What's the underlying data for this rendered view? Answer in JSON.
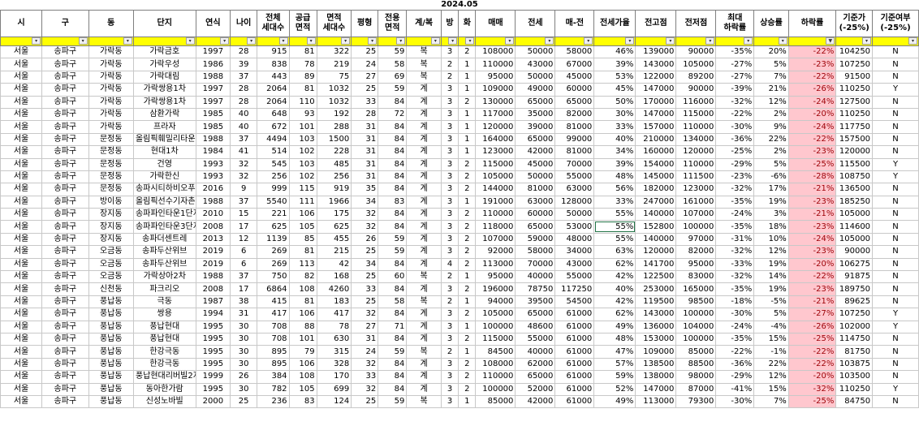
{
  "sheet": {
    "date_label": "2024.05",
    "headers": [
      "시",
      "구",
      "동",
      "단지",
      "연식",
      "나이",
      "전체\n세대수",
      "공급\n면적",
      "면적\n세대수",
      "평형",
      "전용\n면적",
      "계/복",
      "방",
      "화",
      "매매",
      "전세",
      "매-전",
      "전세가율",
      "전고점",
      "전저점",
      "최대\n하락률",
      "상승률",
      "하락률",
      "기준가\n(-25%)",
      "기준여부\n(-25%)"
    ],
    "filter_icons": {
      "default": "dropdown-arrow-icon",
      "active": "filter-icon"
    },
    "rows": [
      [
        "서울",
        "송파구",
        "가락동",
        "가락금호",
        "1997",
        "28",
        "915",
        "81",
        "322",
        "25",
        "59",
        "복",
        "3",
        "2",
        "108000",
        "50000",
        "58000",
        "46%",
        "139000",
        "90000",
        "-35%",
        "20%",
        "-22%",
        "104250",
        "N"
      ],
      [
        "서울",
        "송파구",
        "가락동",
        "가락우성",
        "1986",
        "39",
        "838",
        "78",
        "219",
        "24",
        "58",
        "복",
        "2",
        "1",
        "110000",
        "43000",
        "67000",
        "39%",
        "143000",
        "105000",
        "-27%",
        "5%",
        "-23%",
        "107250",
        "N"
      ],
      [
        "서울",
        "송파구",
        "가락동",
        "가락대림",
        "1988",
        "37",
        "443",
        "89",
        "75",
        "27",
        "69",
        "복",
        "2",
        "1",
        "95000",
        "50000",
        "45000",
        "53%",
        "122000",
        "89200",
        "-27%",
        "7%",
        "-22%",
        "91500",
        "N"
      ],
      [
        "서울",
        "송파구",
        "가락동",
        "가락쌍용1차",
        "1997",
        "28",
        "2064",
        "81",
        "1032",
        "25",
        "59",
        "계",
        "3",
        "1",
        "109000",
        "49000",
        "60000",
        "45%",
        "147000",
        "90000",
        "-39%",
        "21%",
        "-26%",
        "110250",
        "Y"
      ],
      [
        "서울",
        "송파구",
        "가락동",
        "가락쌍용1차",
        "1997",
        "28",
        "2064",
        "110",
        "1032",
        "33",
        "84",
        "계",
        "3",
        "2",
        "130000",
        "65000",
        "65000",
        "50%",
        "170000",
        "116000",
        "-32%",
        "12%",
        "-24%",
        "127500",
        "N"
      ],
      [
        "서울",
        "송파구",
        "가락동",
        "삼환가락",
        "1985",
        "40",
        "648",
        "93",
        "192",
        "28",
        "72",
        "계",
        "3",
        "1",
        "117000",
        "35000",
        "82000",
        "30%",
        "147000",
        "115000",
        "-22%",
        "2%",
        "-20%",
        "110250",
        "N"
      ],
      [
        "서울",
        "송파구",
        "가락동",
        "프라자",
        "1985",
        "40",
        "672",
        "101",
        "288",
        "31",
        "84",
        "계",
        "3",
        "1",
        "120000",
        "39000",
        "81000",
        "33%",
        "157000",
        "110000",
        "-30%",
        "9%",
        "-24%",
        "117750",
        "N"
      ],
      [
        "서울",
        "송파구",
        "문정동",
        "올림픽훼밀리타운",
        "1988",
        "37",
        "4494",
        "103",
        "1500",
        "31",
        "84",
        "계",
        "3",
        "1",
        "164000",
        "65000",
        "99000",
        "40%",
        "210000",
        "134000",
        "-36%",
        "22%",
        "-22%",
        "157500",
        "N"
      ],
      [
        "서울",
        "송파구",
        "문정동",
        "현대1차",
        "1984",
        "41",
        "514",
        "102",
        "228",
        "31",
        "84",
        "계",
        "3",
        "1",
        "123000",
        "42000",
        "81000",
        "34%",
        "160000",
        "120000",
        "-25%",
        "2%",
        "-23%",
        "120000",
        "N"
      ],
      [
        "서울",
        "송파구",
        "문정동",
        "건영",
        "1993",
        "32",
        "545",
        "103",
        "485",
        "31",
        "84",
        "계",
        "3",
        "2",
        "115000",
        "45000",
        "70000",
        "39%",
        "154000",
        "110000",
        "-29%",
        "5%",
        "-25%",
        "115500",
        "Y"
      ],
      [
        "서울",
        "송파구",
        "문정동",
        "가락한신",
        "1993",
        "32",
        "256",
        "102",
        "256",
        "31",
        "84",
        "계",
        "3",
        "2",
        "105000",
        "50000",
        "55000",
        "48%",
        "145000",
        "111500",
        "-23%",
        "-6%",
        "-28%",
        "108750",
        "Y"
      ],
      [
        "서울",
        "송파구",
        "문정동",
        "송파시티하비오푸르지오",
        "2016",
        "9",
        "999",
        "115",
        "919",
        "35",
        "84",
        "계",
        "3",
        "2",
        "144000",
        "81000",
        "63000",
        "56%",
        "182000",
        "123000",
        "-32%",
        "17%",
        "-21%",
        "136500",
        "N"
      ],
      [
        "서울",
        "송파구",
        "방이동",
        "올림픽선수기자촌",
        "1988",
        "37",
        "5540",
        "111",
        "1966",
        "34",
        "83",
        "계",
        "3",
        "1",
        "191000",
        "63000",
        "128000",
        "33%",
        "247000",
        "161000",
        "-35%",
        "19%",
        "-23%",
        "185250",
        "N"
      ],
      [
        "서울",
        "송파구",
        "장지동",
        "송파파인타운1단지",
        "2010",
        "15",
        "221",
        "106",
        "175",
        "32",
        "84",
        "계",
        "3",
        "2",
        "110000",
        "60000",
        "50000",
        "55%",
        "140000",
        "107000",
        "-24%",
        "3%",
        "-21%",
        "105000",
        "N"
      ],
      [
        "서울",
        "송파구",
        "장지동",
        "송파파인타운3단지",
        "2008",
        "17",
        "625",
        "105",
        "625",
        "32",
        "84",
        "계",
        "3",
        "2",
        "118000",
        "65000",
        "53000",
        "55%",
        "152800",
        "100000",
        "-35%",
        "18%",
        "-23%",
        "114600",
        "N"
      ],
      [
        "서울",
        "송파구",
        "장지동",
        "송파더센트레",
        "2013",
        "12",
        "1139",
        "85",
        "455",
        "26",
        "59",
        "계",
        "3",
        "2",
        "107000",
        "59000",
        "48000",
        "55%",
        "140000",
        "97000",
        "-31%",
        "10%",
        "-24%",
        "105000",
        "N"
      ],
      [
        "서울",
        "송파구",
        "오금동",
        "송파두산위브",
        "2019",
        "6",
        "269",
        "81",
        "215",
        "25",
        "59",
        "계",
        "3",
        "2",
        "92000",
        "58000",
        "34000",
        "63%",
        "120000",
        "82000",
        "-32%",
        "12%",
        "-23%",
        "90000",
        "N"
      ],
      [
        "서울",
        "송파구",
        "오금동",
        "송파두산위브",
        "2019",
        "6",
        "269",
        "113",
        "42",
        "34",
        "84",
        "계",
        "4",
        "2",
        "113000",
        "70000",
        "43000",
        "62%",
        "141700",
        "95000",
        "-33%",
        "19%",
        "-20%",
        "106275",
        "N"
      ],
      [
        "서울",
        "송파구",
        "오금동",
        "가락상아2차",
        "1988",
        "37",
        "750",
        "82",
        "168",
        "25",
        "60",
        "복",
        "2",
        "1",
        "95000",
        "40000",
        "55000",
        "42%",
        "122500",
        "83000",
        "-32%",
        "14%",
        "-22%",
        "91875",
        "N"
      ],
      [
        "서울",
        "송파구",
        "신천동",
        "파크리오",
        "2008",
        "17",
        "6864",
        "108",
        "4260",
        "33",
        "84",
        "계",
        "3",
        "2",
        "196000",
        "78750",
        "117250",
        "40%",
        "253000",
        "165000",
        "-35%",
        "19%",
        "-23%",
        "189750",
        "N"
      ],
      [
        "서울",
        "송파구",
        "풍납동",
        "극동",
        "1987",
        "38",
        "415",
        "81",
        "183",
        "25",
        "58",
        "복",
        "2",
        "1",
        "94000",
        "39500",
        "54500",
        "42%",
        "119500",
        "98500",
        "-18%",
        "-5%",
        "-21%",
        "89625",
        "N"
      ],
      [
        "서울",
        "송파구",
        "풍납동",
        "쌍용",
        "1994",
        "31",
        "417",
        "106",
        "417",
        "32",
        "84",
        "계",
        "3",
        "2",
        "105000",
        "65000",
        "61000",
        "62%",
        "143000",
        "100000",
        "-30%",
        "5%",
        "-27%",
        "107250",
        "Y"
      ],
      [
        "서울",
        "송파구",
        "풍납동",
        "풍납현대",
        "1995",
        "30",
        "708",
        "88",
        "78",
        "27",
        "71",
        "계",
        "3",
        "1",
        "100000",
        "48600",
        "61000",
        "49%",
        "136000",
        "104000",
        "-24%",
        "-4%",
        "-26%",
        "102000",
        "Y"
      ],
      [
        "서울",
        "송파구",
        "풍납동",
        "풍납현대",
        "1995",
        "30",
        "708",
        "101",
        "630",
        "31",
        "84",
        "계",
        "3",
        "2",
        "115000",
        "55000",
        "61000",
        "48%",
        "153000",
        "100000",
        "-35%",
        "15%",
        "-25%",
        "114750",
        "N"
      ],
      [
        "서울",
        "송파구",
        "풍납동",
        "한강극동",
        "1995",
        "30",
        "895",
        "79",
        "315",
        "24",
        "59",
        "복",
        "2",
        "1",
        "84500",
        "40000",
        "61000",
        "47%",
        "109000",
        "85000",
        "-22%",
        "-1%",
        "-22%",
        "81750",
        "N"
      ],
      [
        "서울",
        "송파구",
        "풍납동",
        "한강극동",
        "1995",
        "30",
        "895",
        "106",
        "328",
        "32",
        "84",
        "계",
        "3",
        "2",
        "108000",
        "62000",
        "61000",
        "57%",
        "138500",
        "88500",
        "-36%",
        "22%",
        "-22%",
        "103875",
        "N"
      ],
      [
        "서울",
        "송파구",
        "풍납동",
        "풍납현대리버빌2지구",
        "1999",
        "26",
        "384",
        "108",
        "170",
        "33",
        "84",
        "계",
        "3",
        "2",
        "110000",
        "65000",
        "61000",
        "59%",
        "138000",
        "98000",
        "-29%",
        "12%",
        "-20%",
        "103500",
        "N"
      ],
      [
        "서울",
        "송파구",
        "풍납동",
        "동아한가람",
        "1995",
        "30",
        "782",
        "105",
        "699",
        "32",
        "84",
        "계",
        "3",
        "2",
        "100000",
        "52000",
        "61000",
        "52%",
        "147000",
        "87000",
        "-41%",
        "15%",
        "-32%",
        "110250",
        "Y"
      ],
      [
        "서울",
        "송파구",
        "풍납동",
        "신성노바빌",
        "2000",
        "25",
        "236",
        "83",
        "124",
        "25",
        "59",
        "복",
        "3",
        "1",
        "85000",
        "42000",
        "61000",
        "49%",
        "113000",
        "79300",
        "-30%",
        "7%",
        "-25%",
        "84750",
        "N"
      ]
    ]
  }
}
